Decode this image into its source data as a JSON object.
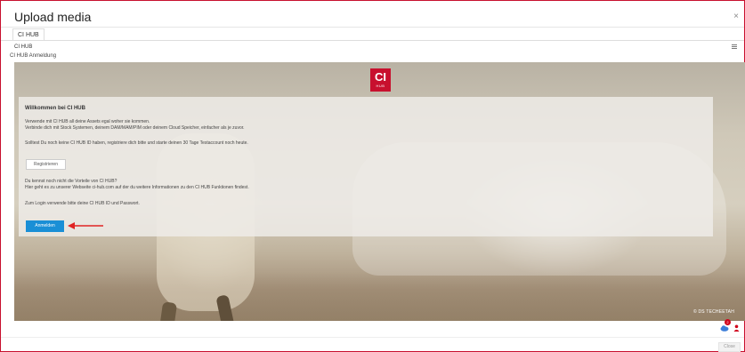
{
  "header": {
    "title": "Upload media",
    "close_glyph": "×"
  },
  "tabs": [
    {
      "label": "CI HUB"
    }
  ],
  "plugin": {
    "name": "CI HUB",
    "subtitle": "CI HUB Anmeldung",
    "menu_icon": "hamburger-menu-icon"
  },
  "logo": {
    "text": "CI",
    "sub": "HUB",
    "color": "#c8102e"
  },
  "panel": {
    "heading": "Willkommen bei CI HUB",
    "line1": "Verwende mit CI HUB all deine Assets egal woher sie kommen.",
    "line2": "Verbinde dich mit Stock Systemen, deinem DAM/MAM/PIM oder deinem Cloud Speicher, einfacher als je zuvor.",
    "line3": "Solltest Du noch keine CI HUB ID haben, registriere dich bitte und starte deinen 30 Tage Testaccount noch heute.",
    "register_label": "Registrieren",
    "line4": "Du kennst noch nicht die Vorteile von CI HUB?",
    "line5": "Hier geht es zu unserer Webseite ci-hub.com auf der du weitere Informationen zu den CI HUB Funktionen findest.",
    "line6": "Zum Login verwende bitte deine CI HUB ID und Passwort.",
    "login_label": "Anmelden",
    "accent": "#1a8fd6",
    "arrow_color": "#e02424"
  },
  "hero": {
    "credit": "© DS TECHEETAH"
  },
  "footer": {
    "notification_count": "2",
    "close_label": "Close",
    "badge_color": "#d0021b"
  }
}
